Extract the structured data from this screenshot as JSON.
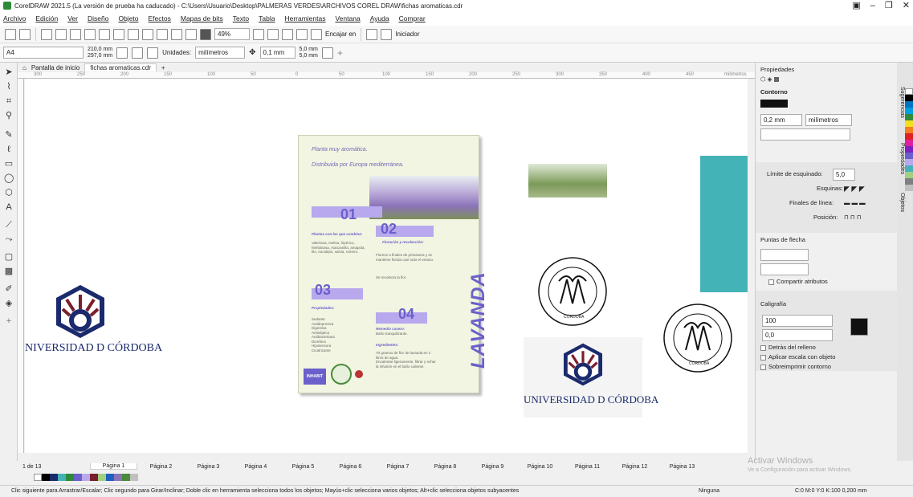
{
  "window": {
    "title": "CorelDRAW 2021.5 (La versión de prueba ha caducado) - C:\\Users\\Usuario\\Desktop\\PALMERAS VERDES\\ARCHIVOS COREL DRAW\\fichas aromaticas.cdr",
    "controls": [
      "▣",
      "–",
      "❐",
      "✕"
    ]
  },
  "menu": [
    "Archivo",
    "Edición",
    "Ver",
    "Diseño",
    "Objeto",
    "Efectos",
    "Mapas de bits",
    "Texto",
    "Tabla",
    "Herramientas",
    "Ventana",
    "Ayuda",
    "Comprar"
  ],
  "toolbar1": {
    "zoom": "49%",
    "snap_label": "Encajar en",
    "launcher_label": "Iniciador"
  },
  "toolbar2": {
    "page_size": "A4",
    "width": "210,0 mm",
    "height": "297,0 mm",
    "units_label": "Unidades:",
    "units_value": "milímetros",
    "nudge": "0,1 mm",
    "dup_x": "5,0 mm",
    "dup_y": "5,0 mm"
  },
  "doc_tabs": {
    "home": "Pantalla de inicio",
    "file": "fichas aromaticas.cdr",
    "add": "+"
  },
  "ruler": {
    "labels": [
      "300",
      "250",
      "200",
      "150",
      "100",
      "50",
      "0",
      "50",
      "100",
      "150",
      "200",
      "250",
      "300",
      "350",
      "400",
      "450"
    ],
    "unit": "milímetros"
  },
  "document": {
    "line1": "Planta muy aromática.",
    "line2": "Distribuida por Europa mediterránea.",
    "num1": "01",
    "num2": "02",
    "num3": "03",
    "num4": "04",
    "head1": "Plantas con las que combina:",
    "body1": "Valeriana, melisa, hipérico, hierbaluisa, manzanilla, amapola, tilo, eucalipto, salvia, romero.",
    "head2": "Floración y recolección:",
    "body2": "Florece a finales de primavera y se mantiene florida casi todo el verano.",
    "body2b": "Se recolecta la flor.",
    "head3": "Propiedades:",
    "body3": "Sedante\nAntidepresiva\nDigestiva\nAntiséptica\nAntibacteriana\nDiurética\nHipotensora\nCicatrizante",
    "head4": "Remedio casero:",
    "body4": "Baño tranquilizante.",
    "head5": "Ingredientes:",
    "body5": "70 gramos de flor de lavanda en 2 litros de agua.\nEncalentar ligeramente, filtrar y echar la infusión en el baño caliente.",
    "vertical_title": "LAVANDA",
    "logo_inhabit": "INHABIT"
  },
  "logos": {
    "uco_left": "NIVERSIDAD D CÓRDOBA",
    "uco_right": "UNIVERSIDAD D CÓRDOBA",
    "stamp_text": "CÓRDOBA"
  },
  "properties": {
    "title": "Propiedades",
    "contorno": "Contorno",
    "width": "0,2 mm",
    "units": "milímetros",
    "miter_label": "Límite de esquinado:",
    "miter_value": "5,0",
    "corners_label": "Esquinas:",
    "caps_label": "Finales de línea:",
    "position_label": "Posición:",
    "arrows_title": "Puntas de flecha",
    "share_attrs": "Compartir atributos",
    "calligraphy_title": "Caligrafía",
    "stretch": "100",
    "angle": "0,0",
    "behind_fill": "Detrás del relleno",
    "scale_with_object": "Aplicar escala con objeto",
    "overprint": "Sobreimprimir contorno",
    "side_tabs": [
      "Sugerencias",
      "Propiedades",
      "Objetos"
    ]
  },
  "pages": {
    "nav": "1 de 13",
    "tabs": [
      "Página 1",
      "Página 2",
      "Página 3",
      "Página 4",
      "Página 5",
      "Página 6",
      "Página 7",
      "Página 8",
      "Página 9",
      "Página 10",
      "Página 11",
      "Página 12",
      "Página 13"
    ]
  },
  "status": {
    "hint": "Clic siguiente para Arrastrar/Escalar; Clic segundo para Girar/Inclinar; Doble clic en herramienta selecciona todos los objetos; Mayús+clic selecciona varios objetos; Alt+clic selecciona objetos subyacentes",
    "fill": "Ninguna",
    "outline": "C:0 M:0 Y:0 K:100  0,200 mm"
  },
  "watermark": {
    "title": "Activar Windows",
    "sub": "Ve a Configuración para activar Windows."
  },
  "colors": {
    "page_bg": "#f1f5e1",
    "lavender": "#b8a9ee",
    "purple_text": "#6a5fcb",
    "teal": "#44b3b8",
    "uco_navy": "#1a2a6c",
    "uco_red": "#7a1f2b"
  }
}
